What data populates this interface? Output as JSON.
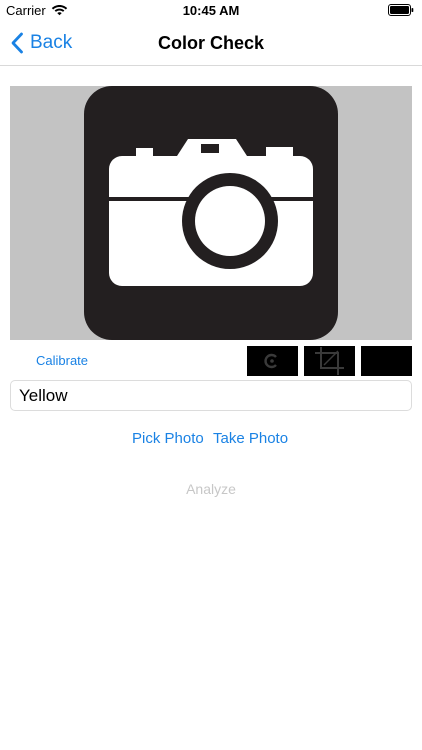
{
  "status_bar": {
    "carrier": "Carrier",
    "time": "10:45 AM",
    "wifi_icon": "wifi-icon",
    "battery_icon": "battery-full-icon"
  },
  "nav": {
    "back_label": "Back",
    "title": "Color Check"
  },
  "image_view": {
    "content_icon": "camera-icon"
  },
  "toolbar": {
    "calibrate_label": "Calibrate",
    "rotate_icon": "rotate-icon",
    "crop_icon": "crop-icon"
  },
  "color_field": {
    "value": "Yellow"
  },
  "actions": {
    "pick_photo_label": "Pick Photo",
    "take_photo_label": "Take Photo",
    "analyze_label": "Analyze"
  },
  "colors": {
    "accent": "#1a82e4",
    "disabled": "#c7c7c7",
    "image_background": "#c3c3c3",
    "camera_tile": "#231f20"
  }
}
